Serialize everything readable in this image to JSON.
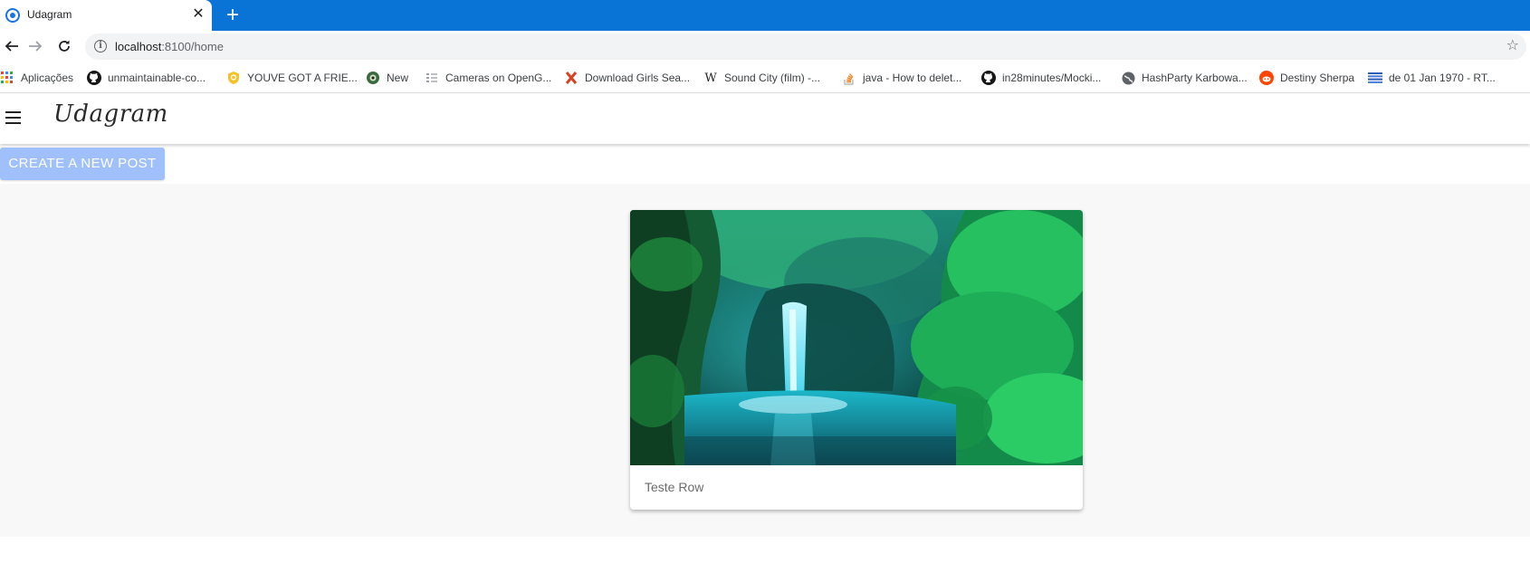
{
  "browser": {
    "tab": {
      "title": "Udagram",
      "close_glyph": "✕"
    },
    "new_tab_glyph": "+",
    "omnibox": {
      "host": "localhost",
      "path": ":8100/home",
      "info_glyph": "i",
      "star_glyph": "☆"
    },
    "bookmarks": [
      {
        "label": "Aplicações",
        "icon": "apps-grid-icon"
      },
      {
        "label": "unmaintainable-co...",
        "icon": "github-icon"
      },
      {
        "label": "YOUVE GOT A FRIE...",
        "icon": "badge-icon"
      },
      {
        "label": "New",
        "icon": "eye-globe-icon"
      },
      {
        "label": "Cameras on OpenG...",
        "icon": "list-icon"
      },
      {
        "label": "Download Girls Sea...",
        "icon": "x-icon"
      },
      {
        "label": "Sound City (film) -...",
        "icon": "wikipedia-icon",
        "glyph": "W"
      },
      {
        "label": "java - How to delet...",
        "icon": "stackoverflow-icon"
      },
      {
        "label": "in28minutes/Mocki...",
        "icon": "github-icon"
      },
      {
        "label": "HashParty Karbowa...",
        "icon": "globe-icon"
      },
      {
        "label": "Destiny Sherpa",
        "icon": "reddit-icon"
      },
      {
        "label": "de 01 Jan 1970 - RT...",
        "icon": "stripes-icon"
      }
    ]
  },
  "app": {
    "title": "Udagram",
    "create_button": "Create a new post",
    "feed": [
      {
        "caption": "Teste Row",
        "image": "waterfall-photo"
      }
    ]
  },
  "colors": {
    "tabstrip": "#0a74d6",
    "create_button": "#9fc0fb",
    "content_background": "#f8f8f8"
  }
}
